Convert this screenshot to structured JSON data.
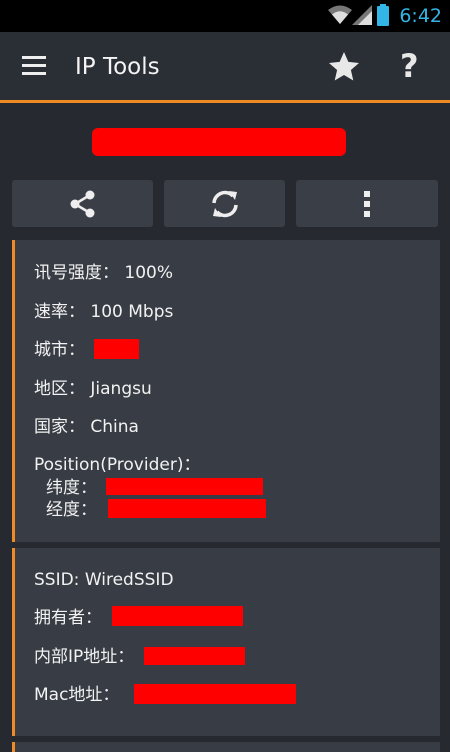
{
  "status_bar": {
    "time": "6:42",
    "icons": [
      "wifi-icon",
      "cell-signal-icon",
      "battery-icon"
    ]
  },
  "action_bar": {
    "title": "IP Tools",
    "icons": [
      "menu-icon",
      "star-icon",
      "help-icon"
    ],
    "help_label": "?"
  },
  "toolbar": {
    "buttons": [
      "share-icon",
      "refresh-icon",
      "overflow-menu-icon"
    ]
  },
  "location_card": {
    "signal_label": "讯号强度：",
    "signal_value": "100%",
    "rate_label": "速率：",
    "rate_value": "100 Mbps",
    "city_label": "城市：",
    "region_label": "地区：",
    "region_value": "Jiangsu",
    "country_label": "国家：",
    "country_value": "China",
    "position_label": "Position(Provider)：",
    "latitude_label": "纬度：",
    "longitude_label": "经度："
  },
  "network_card": {
    "ssid_label": "SSID:",
    "ssid_value": "WiredSSID",
    "owner_label": "拥有者：",
    "internal_ip_label": "内部IP地址：",
    "mac_label": "Mac地址："
  },
  "colors": {
    "accent": "#f08a24",
    "background": "#262a30",
    "card": "#383c44",
    "button": "#3a3f47",
    "redaction": "#ff0000",
    "clock": "#33b5e5"
  }
}
